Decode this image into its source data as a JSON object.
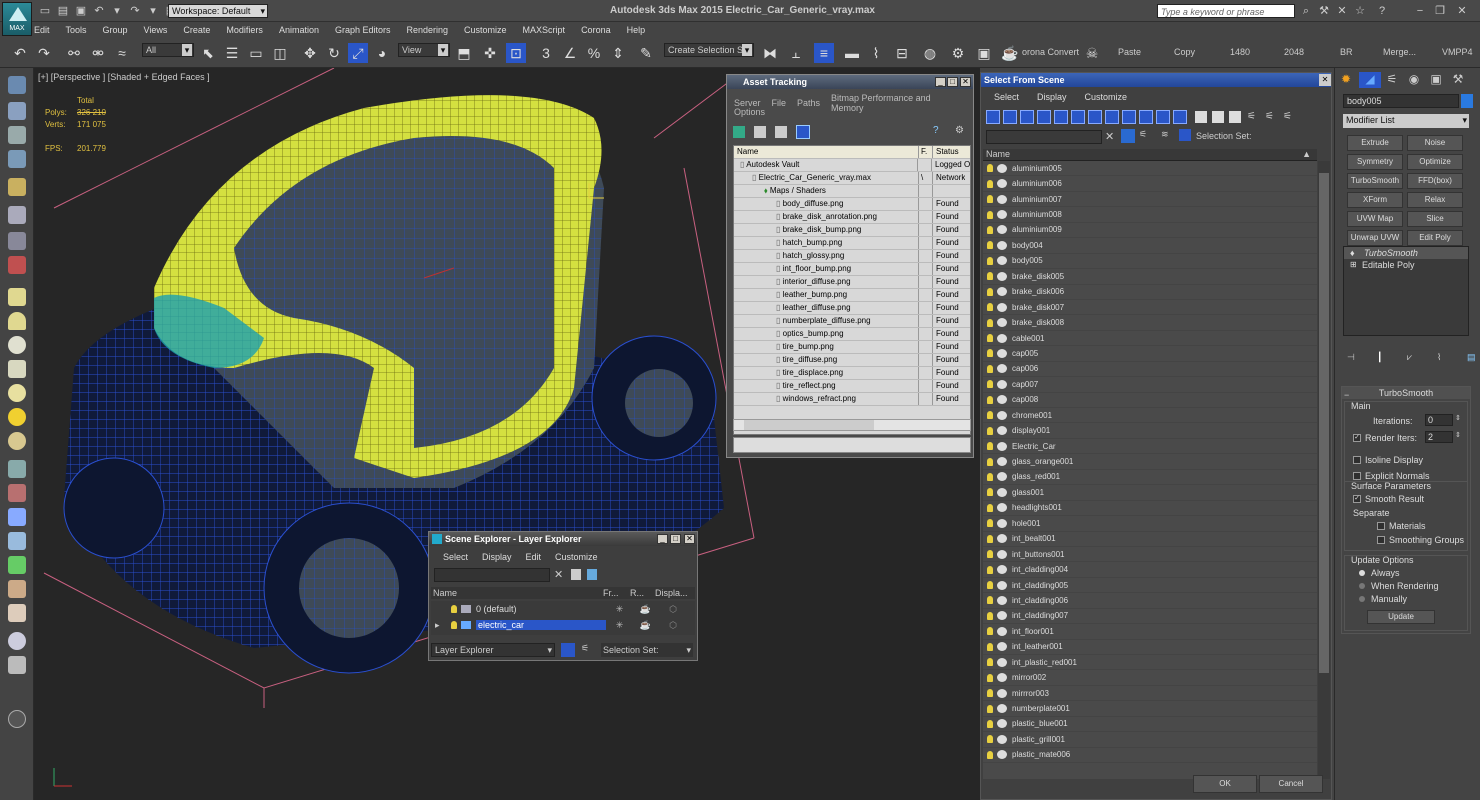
{
  "app": {
    "title": "Autodesk 3ds Max  2015    Electric_Car_Generic_vray.max",
    "logo": "MAX",
    "workspace": "Workspace: Default",
    "search_placeholder": "Type a keyword or phrase"
  },
  "menu": [
    "Edit",
    "Tools",
    "Group",
    "Views",
    "Create",
    "Modifiers",
    "Animation",
    "Graph Editors",
    "Rendering",
    "Customize",
    "MAXScript",
    "Corona",
    "Help"
  ],
  "toolbar": {
    "filter": "All",
    "refcoord": "View",
    "snap_angle": "3",
    "snap_pct": "%",
    "selset": "Create Selection Se",
    "labels": [
      "orona Convert",
      "Paste",
      "Copy",
      "1480",
      "2048",
      "BR",
      "Merge...",
      "VMPP4"
    ]
  },
  "viewport": {
    "label": "[+] [Perspective ] [Shaded + Edged Faces ]",
    "stats_total": "Total",
    "polys_label": "Polys:",
    "polys_value": "326 210",
    "verts_label": "Verts:",
    "verts_value": "171 075",
    "fps_label": "FPS:",
    "fps_value": "201.779"
  },
  "asset": {
    "title": "Asset Tracking",
    "menu": [
      "Server",
      "File",
      "Paths",
      "Bitmap Performance and Memory"
    ],
    "menu2": "Options",
    "col_name": "Name",
    "col_f": "F.",
    "col_status": "Status",
    "rows": [
      {
        "name": "Autodesk Vault",
        "f": "",
        "status": "Logged O",
        "indent": 0
      },
      {
        "name": "Electric_Car_Generic_vray.max",
        "f": "\\",
        "status": "Network",
        "indent": 1
      },
      {
        "name": "Maps / Shaders",
        "f": "",
        "status": "",
        "indent": 2
      },
      {
        "name": "body_diffuse.png",
        "f": "",
        "status": "Found",
        "indent": 3
      },
      {
        "name": "brake_disk_anrotation.png",
        "f": "",
        "status": "Found",
        "indent": 3
      },
      {
        "name": "brake_disk_bump.png",
        "f": "",
        "status": "Found",
        "indent": 3
      },
      {
        "name": "hatch_bump.png",
        "f": "",
        "status": "Found",
        "indent": 3
      },
      {
        "name": "hatch_glossy.png",
        "f": "",
        "status": "Found",
        "indent": 3
      },
      {
        "name": "int_floor_bump.png",
        "f": "",
        "status": "Found",
        "indent": 3
      },
      {
        "name": "interior_diffuse.png",
        "f": "",
        "status": "Found",
        "indent": 3
      },
      {
        "name": "leather_bump.png",
        "f": "",
        "status": "Found",
        "indent": 3
      },
      {
        "name": "leather_diffuse.png",
        "f": "",
        "status": "Found",
        "indent": 3
      },
      {
        "name": "numberplate_diffuse.png",
        "f": "",
        "status": "Found",
        "indent": 3
      },
      {
        "name": "optics_bump.png",
        "f": "",
        "status": "Found",
        "indent": 3
      },
      {
        "name": "tire_bump.png",
        "f": "",
        "status": "Found",
        "indent": 3
      },
      {
        "name": "tire_diffuse.png",
        "f": "",
        "status": "Found",
        "indent": 3
      },
      {
        "name": "tire_displace.png",
        "f": "",
        "status": "Found",
        "indent": 3
      },
      {
        "name": "tire_reflect.png",
        "f": "",
        "status": "Found",
        "indent": 3
      },
      {
        "name": "windows_refract.png",
        "f": "",
        "status": "Found",
        "indent": 3
      }
    ]
  },
  "selscene": {
    "title": "Select From Scene",
    "menu": [
      "Select",
      "Display",
      "Customize"
    ],
    "selset_label": "Selection Set:",
    "col_name": "Name",
    "ok": "OK",
    "cancel": "Cancel",
    "items": [
      "aluminium005",
      "aluminium006",
      "aluminium007",
      "aluminium008",
      "aluminium009",
      "body004",
      "body005",
      "brake_disk005",
      "brake_disk006",
      "brake_disk007",
      "brake_disk008",
      "cable001",
      "cap005",
      "cap006",
      "cap007",
      "cap008",
      "chrome001",
      "display001",
      "Electric_Car",
      "glass_orange001",
      "glass_red001",
      "glass001",
      "headlights001",
      "hole001",
      "int_bealt001",
      "int_buttons001",
      "int_cladding004",
      "int_cladding005",
      "int_cladding006",
      "int_cladding007",
      "int_floor001",
      "int_leather001",
      "int_plastic_red001",
      "mirror002",
      "mirrror003",
      "numberplate001",
      "plastic_blue001",
      "plastic_grill001",
      "plastic_mate006"
    ]
  },
  "sceneexp": {
    "title": "Scene Explorer - Layer Explorer",
    "menu": [
      "Select",
      "Display",
      "Edit",
      "Customize"
    ],
    "cols": [
      "Name",
      "Fr...",
      "R...",
      "Displa..."
    ],
    "rows": [
      "0 (default)",
      "electric_car"
    ],
    "footer_left": "Layer Explorer",
    "footer_right": "Selection Set:"
  },
  "cmd": {
    "object_name": "body005",
    "modifier_list": "Modifier List",
    "buttons": [
      "Extrude",
      "Noise",
      "Symmetry",
      "Optimize",
      "TurboSmooth",
      "FFD(box)",
      "XForm",
      "Relax",
      "UVW Map",
      "Slice",
      "Unwrap UVW",
      "Edit Poly"
    ],
    "stack": [
      "TurboSmooth",
      "Editable Poly"
    ],
    "rollout": "TurboSmooth",
    "main": "Main",
    "iterations_label": "Iterations:",
    "iterations": "0",
    "render_iters_label": "Render Iters:",
    "render_iters": "2",
    "isoline": "Isoline Display",
    "explicit": "Explicit Normals",
    "surface": "Surface Parameters",
    "smooth_result": "Smooth Result",
    "separate": "Separate",
    "materials": "Materials",
    "smoothing": "Smoothing Groups",
    "update_options": "Update Options",
    "always": "Always",
    "when_rendering": "When Rendering",
    "manually": "Manually",
    "update": "Update"
  },
  "colors": {
    "mesh_yellow": "#d4e040",
    "mesh_blue": "#1c3c9c",
    "selection": "#2a56c8"
  }
}
